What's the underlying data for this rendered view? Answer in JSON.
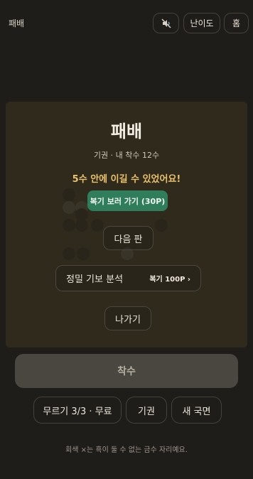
{
  "header": {
    "title": "패배",
    "sound_icon": "sound-muted-icon",
    "level_label": "난이도",
    "home_label": "홈"
  },
  "result": {
    "title": "패배",
    "subtitle": "기권 · 내 착수 12수",
    "message": "5수 안에 이길 수 있었어요!",
    "review_button": "복기 보러 가기 (30P)",
    "next_button": "다음 판",
    "analysis_label": "정밀 기보 분석",
    "analysis_cost": "복기 100P ›",
    "exit_button": "나가기"
  },
  "controls": {
    "place_label": "착수",
    "undo_label": "무르기 3/3 · 무료",
    "resign_label": "기권",
    "new_game_label": "새 국면"
  },
  "footnote": "회색 ×는 흑이 둘 수 없는 금수 자리예요.",
  "colors": {
    "accent_green": "#2f7d5a",
    "message_gold": "#e9c16d",
    "background": "#1f1d1a"
  }
}
